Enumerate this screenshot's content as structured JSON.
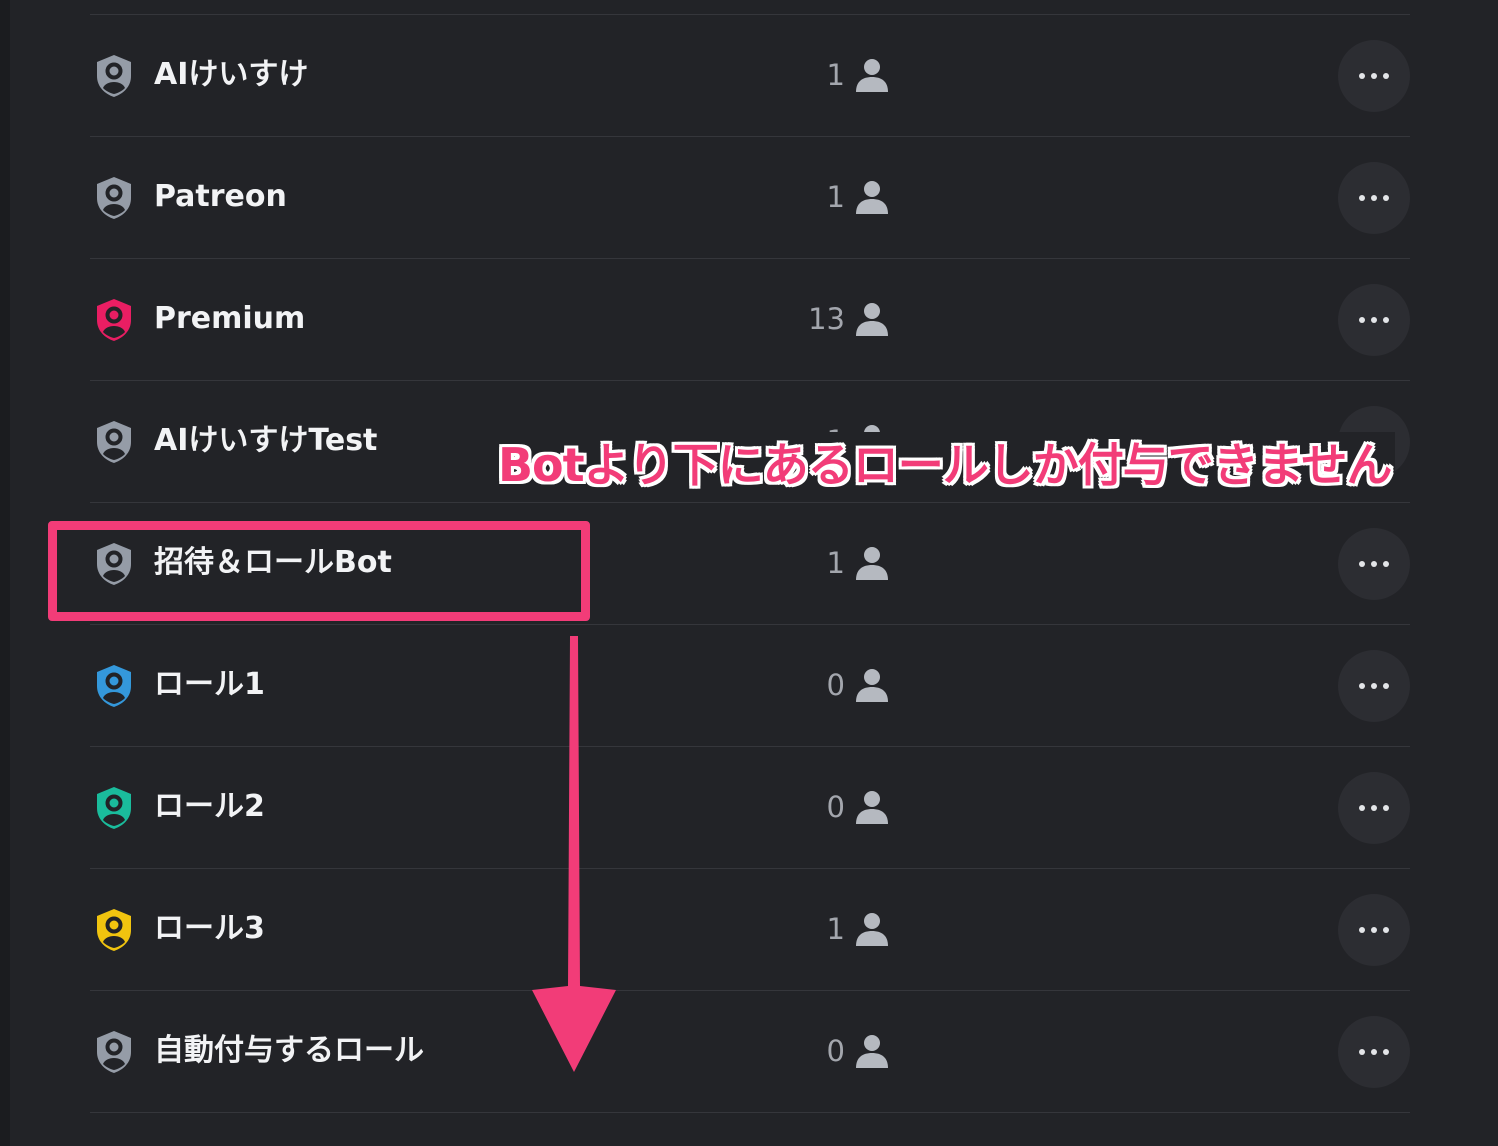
{
  "roles": [
    {
      "name": "AIけいすけ",
      "count": "1",
      "color": "#959ca7"
    },
    {
      "name": "Patreon",
      "count": "1",
      "color": "#959ca7"
    },
    {
      "name": "Premium",
      "count": "13",
      "color": "#e91e63"
    },
    {
      "name": "AIけいすけTest",
      "count": "1",
      "color": "#959ca7"
    },
    {
      "name": "招待＆ロールBot",
      "count": "1",
      "color": "#959ca7"
    },
    {
      "name": "ロール1",
      "count": "0",
      "color": "#3498db"
    },
    {
      "name": "ロール2",
      "count": "0",
      "color": "#1abc9c"
    },
    {
      "name": "ロール3",
      "count": "1",
      "color": "#f1c40f"
    },
    {
      "name": "自動付与するロール",
      "count": "0",
      "color": "#959ca7"
    }
  ],
  "annotation": {
    "text": "Botより下にあるロールしか付与できません",
    "color": "#f23c78"
  },
  "icons": {
    "role": "shield-person-icon",
    "members": "person-icon",
    "more": "ellipsis-icon"
  }
}
